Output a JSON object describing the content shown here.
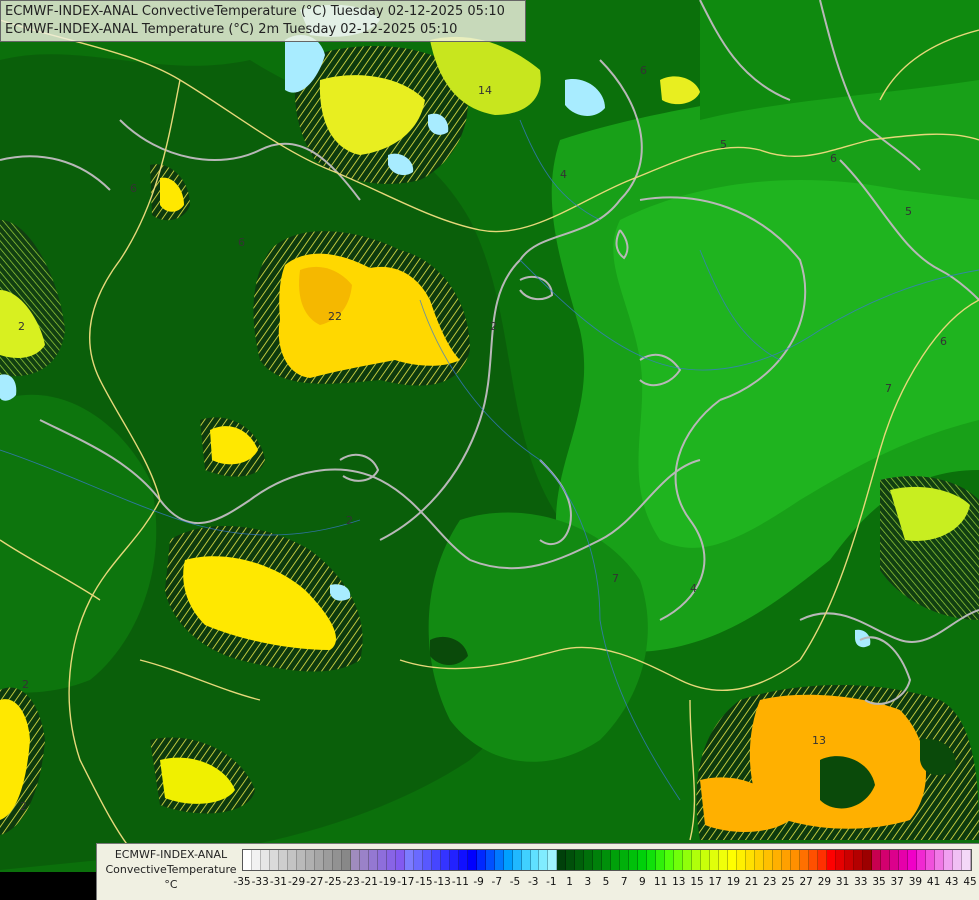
{
  "title": {
    "line1": "ECMWF-INDEX-ANAL ConvectiveTemperature (°C) Tuesday 02-12-2025 05:10",
    "line2": "ECMWF-INDEX-ANAL Temperature (°C) 2m Tuesday 02-12-2025 05:10"
  },
  "legend": {
    "model": "ECMWF-INDEX-ANAL",
    "parameter": "ConvectiveTemperature",
    "unit": "°C",
    "tick_labels": [
      "-35",
      "-33",
      "-31",
      "-29",
      "-27",
      "-25",
      "-23",
      "-21",
      "-19",
      "-17",
      "-15",
      "-13",
      "-11",
      "-9",
      "-7",
      "-5",
      "-3",
      "-1",
      "1",
      "3",
      "5",
      "7",
      "9",
      "11",
      "13",
      "15",
      "17",
      "19",
      "21",
      "23",
      "25",
      "27",
      "29",
      "31",
      "33",
      "35",
      "37",
      "39",
      "41",
      "43",
      "45"
    ],
    "colors": [
      "#ffffff",
      "#f2f2f2",
      "#e6e6e6",
      "#dadada",
      "#cecece",
      "#c4c4c4",
      "#bababa",
      "#b0b0b0",
      "#a6a6a6",
      "#9c9c9c",
      "#929292",
      "#888888",
      "#a08cbe",
      "#9a82c8",
      "#9478d2",
      "#8e6edc",
      "#8864e6",
      "#825af0",
      "#7c7cff",
      "#6a6aff",
      "#5858ff",
      "#4646ff",
      "#3434ff",
      "#2222ff",
      "#1010ff",
      "#0000ff",
      "#0028ff",
      "#0050ff",
      "#0078ff",
      "#00a0ff",
      "#20b8ff",
      "#40d0ff",
      "#60e0ff",
      "#80ecff",
      "#a0f4ff",
      "#00400a",
      "#00500a",
      "#00600a",
      "#00700a",
      "#00800a",
      "#00900a",
      "#00a00a",
      "#00b00a",
      "#00c00a",
      "#00d00a",
      "#10e00a",
      "#30f00a",
      "#50ff0a",
      "#70ff0a",
      "#90ff0a",
      "#b0ff0a",
      "#c8ff0a",
      "#e0ff0a",
      "#f0ff0a",
      "#ffff00",
      "#fff000",
      "#ffe000",
      "#ffd000",
      "#ffc000",
      "#ffb000",
      "#ffa000",
      "#ff9000",
      "#ff7000",
      "#ff5000",
      "#ff3000",
      "#ff0000",
      "#e60000",
      "#cc0000",
      "#b40000",
      "#9c0000",
      "#c80050",
      "#d2006e",
      "#dc008c",
      "#e600aa",
      "#f000c8",
      "#f028d2",
      "#f050dc",
      "#f078e6",
      "#f0a0f0",
      "#f0c0f4",
      "#f4d8f8"
    ]
  },
  "contour_labels": [
    "14",
    "6",
    "6",
    "6",
    "6",
    "4",
    "2",
    "2",
    "22",
    "5",
    "5",
    "6",
    "7",
    "2",
    "7",
    "2",
    "4",
    "13",
    "2"
  ]
}
